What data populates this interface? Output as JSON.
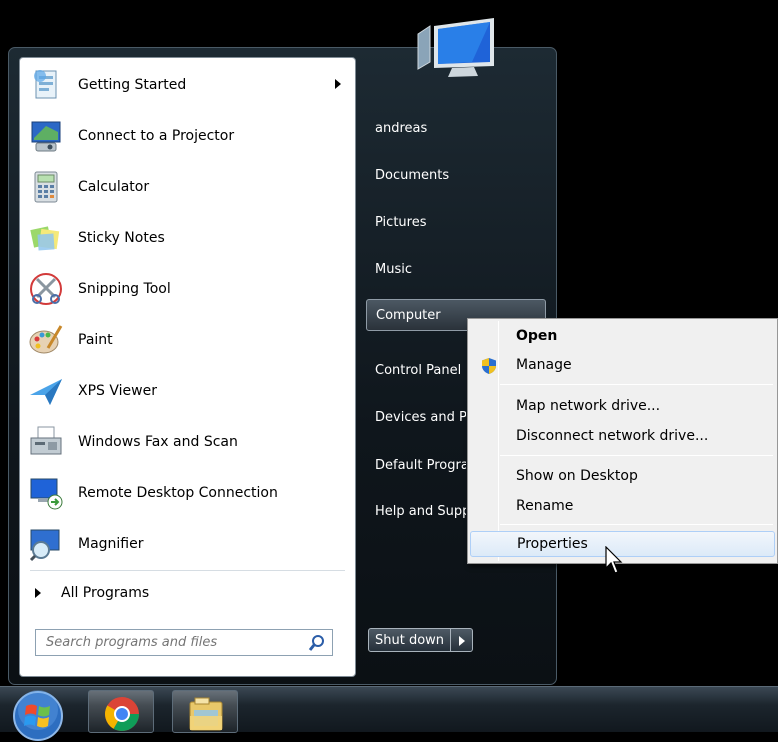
{
  "programs": [
    {
      "label": "Getting Started",
      "icon": "getting-started-icon",
      "has_submenu": true
    },
    {
      "label": "Connect to a Projector",
      "icon": "projector-icon"
    },
    {
      "label": "Calculator",
      "icon": "calculator-icon"
    },
    {
      "label": "Sticky Notes",
      "icon": "sticky-notes-icon"
    },
    {
      "label": "Snipping Tool",
      "icon": "scissors-icon"
    },
    {
      "label": "Paint",
      "icon": "paint-palette-icon"
    },
    {
      "label": "XPS Viewer",
      "icon": "paper-plane-icon"
    },
    {
      "label": "Windows Fax and Scan",
      "icon": "fax-icon"
    },
    {
      "label": "Remote Desktop Connection",
      "icon": "remote-desktop-icon"
    },
    {
      "label": "Magnifier",
      "icon": "magnifier-icon"
    }
  ],
  "all_programs_label": "All Programs",
  "search": {
    "placeholder": "Search programs and files"
  },
  "right_pane": [
    {
      "label": "andreas"
    },
    {
      "label": "Documents"
    },
    {
      "label": "Pictures"
    },
    {
      "label": "Music"
    },
    {
      "label": "Computer",
      "highlighted": true
    },
    {
      "label": "Control Panel"
    },
    {
      "label": "Devices and Printers"
    },
    {
      "label": "Default Programs"
    },
    {
      "label": "Help and Support"
    }
  ],
  "shutdown": {
    "label": "Shut down"
  },
  "context_menu": {
    "items": [
      {
        "label": "Open",
        "bold": true
      },
      {
        "label": "Manage",
        "icon": "uac-shield-icon"
      },
      {
        "label": "Map network drive..."
      },
      {
        "label": "Disconnect network drive..."
      },
      {
        "label": "Show on Desktop"
      },
      {
        "label": "Rename"
      },
      {
        "label": "Properties",
        "highlighted": true
      }
    ]
  },
  "taskbar": {
    "items": [
      {
        "name": "start-orb",
        "icon": "windows-logo-icon"
      },
      {
        "name": "chrome",
        "icon": "chrome-icon"
      },
      {
        "name": "explorer",
        "icon": "folder-icon"
      }
    ]
  },
  "colors": {
    "menu_bg": "#0f161c",
    "left_pane_bg": "#ffffff",
    "highlight_border": "#aecff7",
    "taskbar_bg": "#1c252d"
  }
}
